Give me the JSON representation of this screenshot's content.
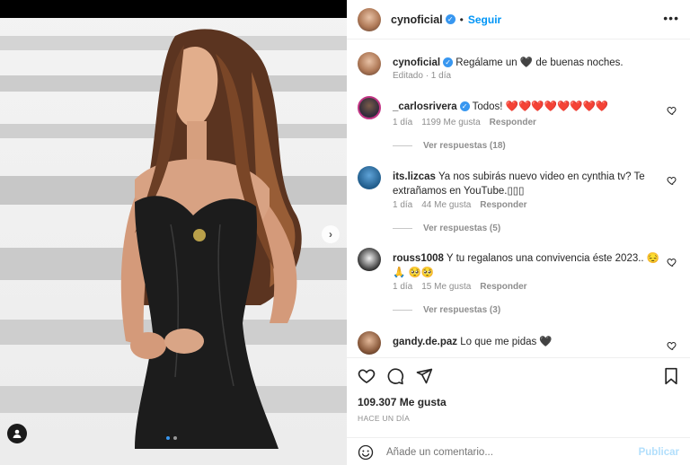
{
  "post": {
    "username": "cynoficial",
    "separator": "•",
    "follow_label": "Seguir",
    "more_icon": "more-horizontal-icon",
    "caption": "Regálame un 🖤 de buenas noches.",
    "caption_meta": "Editado · 1 día"
  },
  "comments": [
    {
      "username": "_carlosrivera",
      "verified": true,
      "text": "Todos! ❤️❤️❤️❤️❤️❤️❤️❤️",
      "time": "1 día",
      "likes": "1199 Me gusta",
      "reply": "Responder",
      "view_replies": "Ver respuestas (18)"
    },
    {
      "username": "its.lizcas",
      "verified": false,
      "text": "Ya nos subirás nuevo video en cynthia tv? Te extrañamos en YouTube.▯▯▯",
      "time": "1 día",
      "likes": "44 Me gusta",
      "reply": "Responder",
      "view_replies": "Ver respuestas (5)"
    },
    {
      "username": "rouss1008",
      "verified": false,
      "text": "Y tu regalanos una convivencia éste 2023.. 😔🙏 🥺🥺",
      "time": "1 día",
      "likes": "15 Me gusta",
      "reply": "Responder",
      "view_replies": "Ver respuestas (3)"
    },
    {
      "username": "gandy.de.paz",
      "verified": false,
      "text": "Lo que me pidas 🖤"
    }
  ],
  "actions": {
    "likes": "109.307 Me gusta",
    "time_ago": "HACE UN DÍA",
    "comment_placeholder": "Añade un comentario...",
    "publish_label": "Publicar"
  },
  "colors": {
    "accent": "#0095f6",
    "verified": "#3897f0",
    "muted": "#8e8e8e",
    "text": "#262626"
  }
}
